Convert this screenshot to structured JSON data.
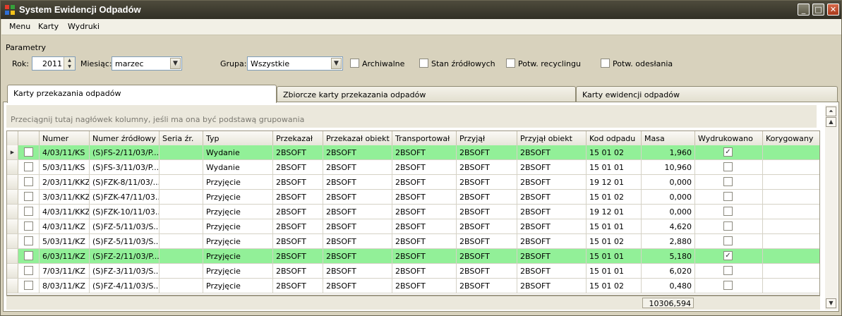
{
  "window": {
    "title": "System Ewidencji Odpadów"
  },
  "menu": [
    "Menu",
    "Karty",
    "Wydruki"
  ],
  "params": {
    "section_label": "Parametry",
    "rok_label": "Rok:",
    "rok_value": "2011",
    "miesiac_label": "Miesiąc:",
    "miesiac_value": "marzec",
    "grupa_label": "Grupa:",
    "grupa_value": "Wszystkie",
    "checkboxes": [
      "Archiwalne",
      "Stan źródłowych",
      "Potw. recyclingu",
      "Potw. odesłania"
    ]
  },
  "tabs": [
    "Karty przekazania odpadów",
    "Zbiorcze karty przekazania odpadów",
    "Karty ewidencji odpadów"
  ],
  "grid": {
    "group_hint": "Przeciągnij tutaj nagłówek kolumny, jeśli ma ona być podstawą grupowania",
    "columns": [
      "Numer",
      "Numer źródłowy",
      "Seria źr.",
      "Typ",
      "Przekazał",
      "Przekazał obiekt",
      "Transportował",
      "Przyjął",
      "Przyjął obiekt",
      "Kod odpadu",
      "Masa",
      "Wydrukowano",
      "Korygowany"
    ],
    "rows": [
      {
        "numer": "4/03/11/KS",
        "zrodlowy": "(S)FS-2/11/03/P...",
        "seria": "",
        "typ": "Wydanie",
        "przekazal": "2BSOFT",
        "przekazal_obiekt": "2BSOFT",
        "transportowal": "2BSOFT",
        "przyjal": "2BSOFT",
        "przyjal_obiekt": "2BSOFT",
        "kod": "15 01 02",
        "masa": "1,960",
        "wydrukowano": true,
        "highlight": true,
        "current": true
      },
      {
        "numer": "5/03/11/KS",
        "zrodlowy": "(S)FS-3/11/03/P...",
        "seria": "",
        "typ": "Wydanie",
        "przekazal": "2BSOFT",
        "przekazal_obiekt": "2BSOFT",
        "transportowal": "2BSOFT",
        "przyjal": "2BSOFT",
        "przyjal_obiekt": "2BSOFT",
        "kod": "15 01 01",
        "masa": "10,960",
        "wydrukowano": false,
        "highlight": false,
        "current": false
      },
      {
        "numer": "2/03/11/KKZ",
        "zrodlowy": "(S)FZK-8/11/03/...",
        "seria": "",
        "typ": "Przyjęcie",
        "przekazal": "2BSOFT",
        "przekazal_obiekt": "2BSOFT",
        "transportowal": "2BSOFT",
        "przyjal": "2BSOFT",
        "przyjal_obiekt": "2BSOFT",
        "kod": "19 12 01",
        "masa": "0,000",
        "wydrukowano": false,
        "highlight": false,
        "current": false
      },
      {
        "numer": "3/03/11/KKZ",
        "zrodlowy": "(S)FZK-47/11/03...",
        "seria": "",
        "typ": "Przyjęcie",
        "przekazal": "2BSOFT",
        "przekazal_obiekt": "2BSOFT",
        "transportowal": "2BSOFT",
        "przyjal": "2BSOFT",
        "przyjal_obiekt": "2BSOFT",
        "kod": "15 01 02",
        "masa": "0,000",
        "wydrukowano": false,
        "highlight": false,
        "current": false
      },
      {
        "numer": "4/03/11/KKZ",
        "zrodlowy": "(S)FZK-10/11/03...",
        "seria": "",
        "typ": "Przyjęcie",
        "przekazal": "2BSOFT",
        "przekazal_obiekt": "2BSOFT",
        "transportowal": "2BSOFT",
        "przyjal": "2BSOFT",
        "przyjal_obiekt": "2BSOFT",
        "kod": "19 12 01",
        "masa": "0,000",
        "wydrukowano": false,
        "highlight": false,
        "current": false
      },
      {
        "numer": "4/03/11/KZ",
        "zrodlowy": "(S)FZ-5/11/03/S...",
        "seria": "",
        "typ": "Przyjęcie",
        "przekazal": "2BSOFT",
        "przekazal_obiekt": "2BSOFT",
        "transportowal": "2BSOFT",
        "przyjal": "2BSOFT",
        "przyjal_obiekt": "2BSOFT",
        "kod": "15 01 01",
        "masa": "4,620",
        "wydrukowano": false,
        "highlight": false,
        "current": false
      },
      {
        "numer": "5/03/11/KZ",
        "zrodlowy": "(S)FZ-5/11/03/S...",
        "seria": "",
        "typ": "Przyjęcie",
        "przekazal": "2BSOFT",
        "przekazal_obiekt": "2BSOFT",
        "transportowal": "2BSOFT",
        "przyjal": "2BSOFT",
        "przyjal_obiekt": "2BSOFT",
        "kod": "15 01 02",
        "masa": "2,880",
        "wydrukowano": false,
        "highlight": false,
        "current": false
      },
      {
        "numer": "6/03/11/KZ",
        "zrodlowy": "(S)FZ-2/11/03/P...",
        "seria": "",
        "typ": "Przyjęcie",
        "przekazal": "2BSOFT",
        "przekazal_obiekt": "2BSOFT",
        "transportowal": "2BSOFT",
        "przyjal": "2BSOFT",
        "przyjal_obiekt": "2BSOFT",
        "kod": "15 01 01",
        "masa": "5,180",
        "wydrukowano": true,
        "highlight": true,
        "current": false
      },
      {
        "numer": "7/03/11/KZ",
        "zrodlowy": "(S)FZ-3/11/03/S...",
        "seria": "",
        "typ": "Przyjęcie",
        "przekazal": "2BSOFT",
        "przekazal_obiekt": "2BSOFT",
        "transportowal": "2BSOFT",
        "przyjal": "2BSOFT",
        "przyjal_obiekt": "2BSOFT",
        "kod": "15 01 01",
        "masa": "6,020",
        "wydrukowano": false,
        "highlight": false,
        "current": false
      },
      {
        "numer": "8/03/11/KZ",
        "zrodlowy": "(S)FZ-4/11/03/S...",
        "seria": "",
        "typ": "Przyjęcie",
        "przekazal": "2BSOFT",
        "przekazal_obiekt": "2BSOFT",
        "transportowal": "2BSOFT",
        "przyjal": "2BSOFT",
        "przyjal_obiekt": "2BSOFT",
        "kod": "15 01 02",
        "masa": "0,480",
        "wydrukowano": false,
        "highlight": false,
        "current": false
      }
    ],
    "total_masa": "10306,594"
  },
  "colors": {
    "highlight_row": "#92f098",
    "titlebar": "#3d3a2e"
  }
}
